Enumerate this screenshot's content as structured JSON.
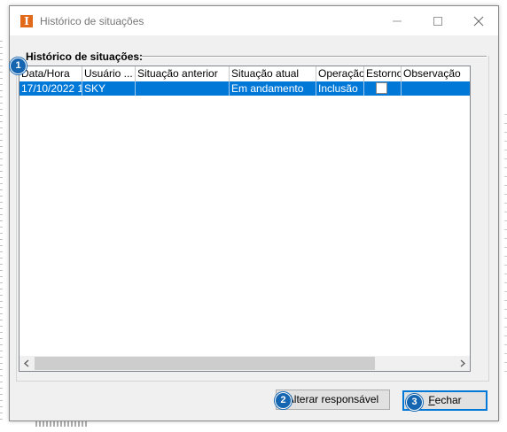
{
  "window": {
    "title": "Histórico de situações",
    "icon_letter": "I",
    "icon_color": "#e3691a"
  },
  "group": {
    "title": "Histórico de situações:"
  },
  "grid": {
    "columns": [
      "Data/Hora",
      "Usuário ...",
      "Situação anterior",
      "Situação atual",
      "Operação",
      "Estorno",
      "Observação"
    ],
    "rows": [
      {
        "data_hora": "17/10/2022 1",
        "usuario": "SKY",
        "situacao_anterior": "",
        "situacao_atual": "Em andamento",
        "operacao": "Inclusão",
        "estorno": false,
        "observacao": ""
      }
    ],
    "selected_row_color": "#0078d7"
  },
  "buttons": {
    "alterar": "Alterar responsável",
    "fechar_prefix": "",
    "fechar_mnemonic": "F",
    "fechar_rest": "echar"
  },
  "badges": {
    "one": "1",
    "two": "2",
    "three": "3",
    "color": "#1565b0"
  }
}
